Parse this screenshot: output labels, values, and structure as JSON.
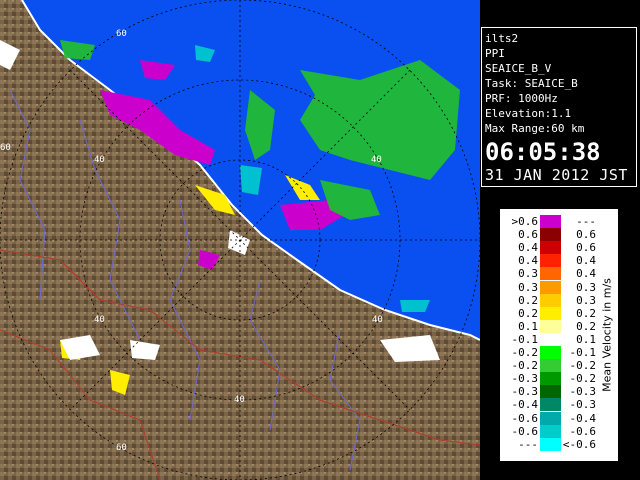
{
  "info": {
    "site": "ilts2",
    "product": "PPI",
    "product_name": "SEAICE_B_V",
    "task": "Task: SEAICE_B",
    "prf": "PRF: 1000Hz",
    "elevation": "Elevation:1.1",
    "max_range": "Max Range:60 km",
    "time": "06:05:38",
    "date": "31 JAN 2012 JST"
  },
  "range_ring_labels": [
    "60",
    "60",
    "40",
    "40",
    "40",
    "40",
    "40",
    "60"
  ],
  "legend": {
    "unit_label": "Mean Velocity in m/s",
    "rows": [
      {
        "lo": ">0.6",
        "hi": "---",
        "color": "#cc00cc"
      },
      {
        "lo": "0.6",
        "hi": "0.6",
        "color": "#8b0000"
      },
      {
        "lo": "0.4",
        "hi": "0.6",
        "color": "#cc0000"
      },
      {
        "lo": "0.4",
        "hi": "0.4",
        "color": "#ff2200"
      },
      {
        "lo": "0.3",
        "hi": "0.4",
        "color": "#ff6600"
      },
      {
        "lo": "0.3",
        "hi": "0.3",
        "color": "#ff9900"
      },
      {
        "lo": "0.2",
        "hi": "0.3",
        "color": "#ffcc00"
      },
      {
        "lo": "0.2",
        "hi": "0.2",
        "color": "#ffee00"
      },
      {
        "lo": "0.1",
        "hi": "0.2",
        "color": "#ffff99"
      },
      {
        "lo": "-0.1",
        "hi": "0.1",
        "color": "#ffffff"
      },
      {
        "lo": "-0.2",
        "hi": "-0.1",
        "color": "#00ff00"
      },
      {
        "lo": "-0.2",
        "hi": "-0.2",
        "color": "#33cc33"
      },
      {
        "lo": "-0.3",
        "hi": "-0.2",
        "color": "#009900"
      },
      {
        "lo": "-0.3",
        "hi": "-0.3",
        "color": "#006600"
      },
      {
        "lo": "-0.4",
        "hi": "-0.3",
        "color": "#008866"
      },
      {
        "lo": "-0.6",
        "hi": "-0.4",
        "color": "#00aaaa"
      },
      {
        "lo": "-0.6",
        "hi": "-0.6",
        "color": "#00cccc"
      },
      {
        "lo": "---",
        "hi": "<-0.6",
        "color": "#00ffff"
      }
    ]
  },
  "colors": {
    "sea": "#0a4ff0",
    "land": "#7a6448",
    "background": "#000000"
  }
}
